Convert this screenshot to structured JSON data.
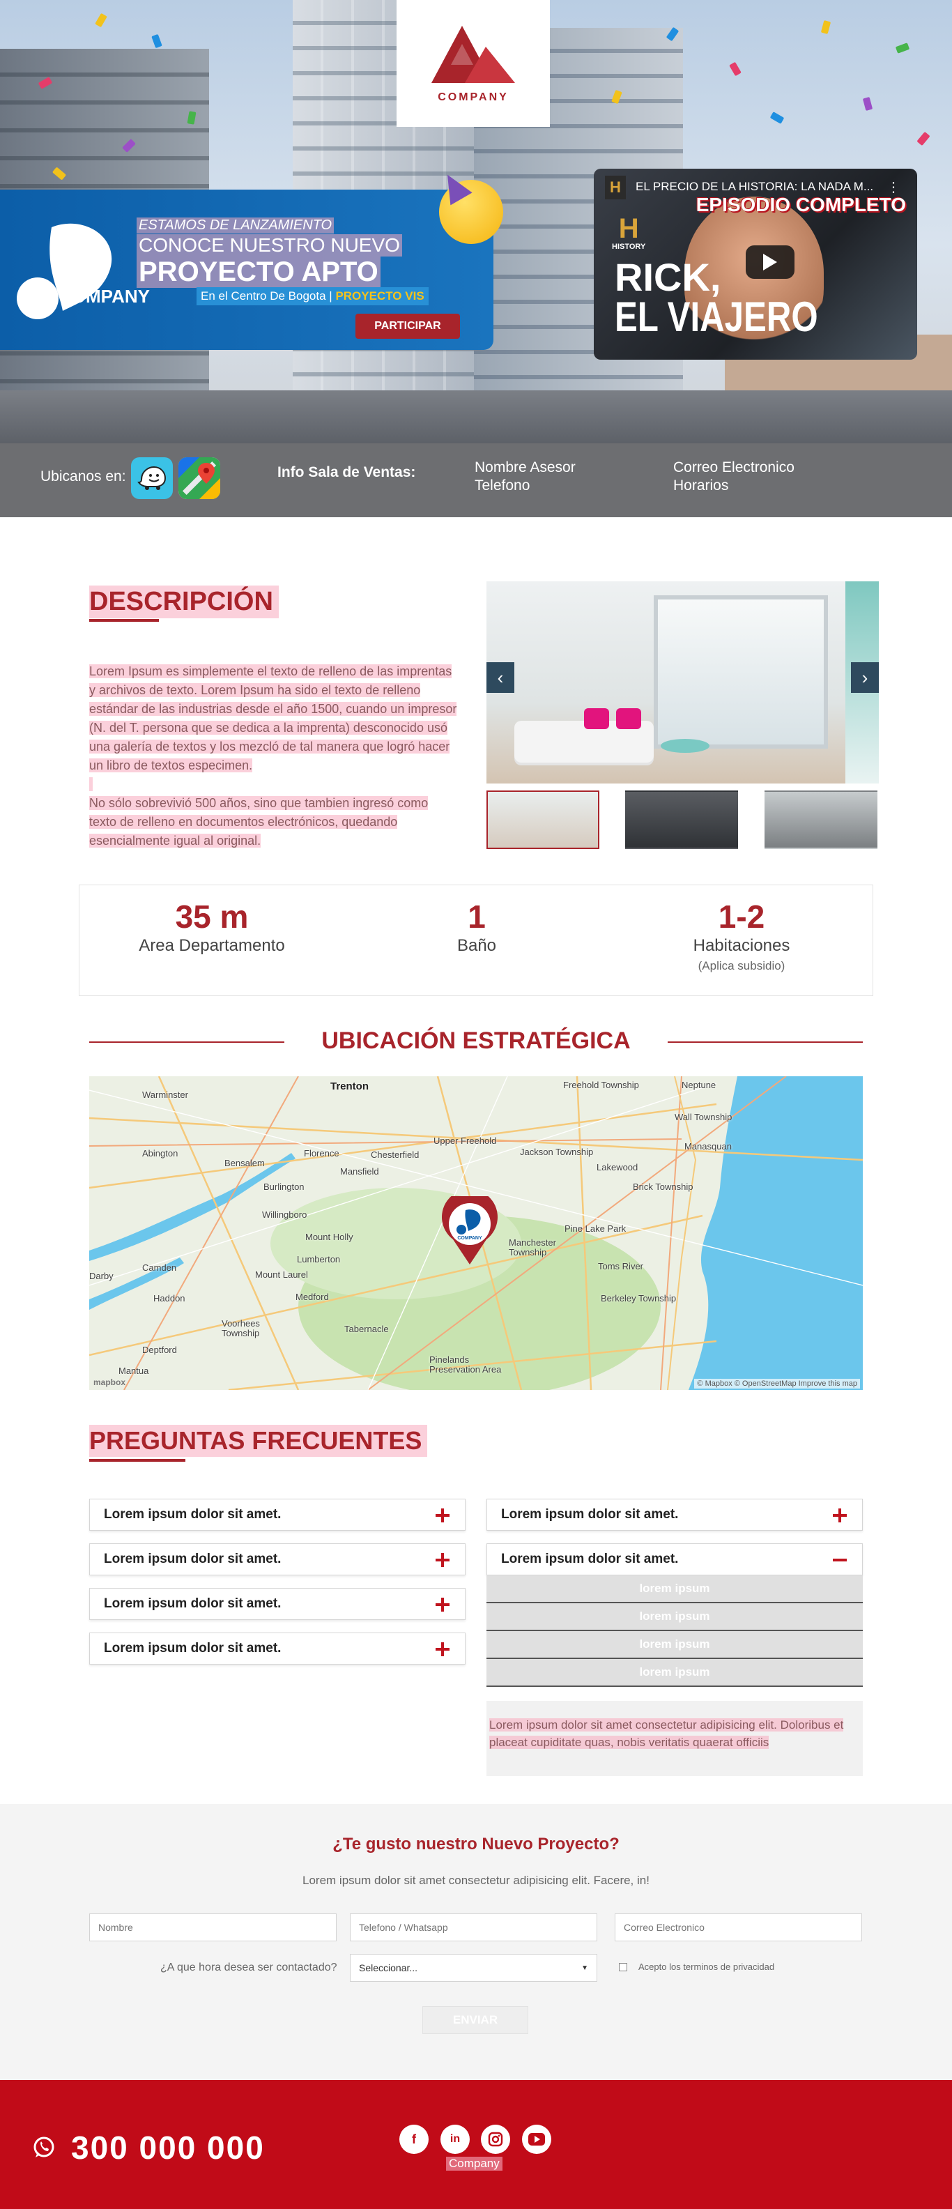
{
  "header": {
    "logo_text": "COMPANY"
  },
  "hero": {
    "brand_name": "COMPANY",
    "line1": "ESTAMOS DE LANZAMIENTO",
    "line2": "CONOCE NUESTRO NUEVO",
    "line3": "PROYECTO APTO",
    "location": "En el Centro De Bogota |",
    "vis": "PROYECTO VIS",
    "cta": "PARTICIPAR",
    "video": {
      "title": "EL PRECIO DE LA HISTORIA: LA NADA M...",
      "badge": "EPISODIO COMPLETO",
      "channel_letter": "H",
      "channel_name": "HISTORY",
      "show_line1": "RICK,",
      "show_line2": "EL VIAJERO"
    }
  },
  "infobar": {
    "ubicanos": "Ubicanos en:",
    "sala": "Info Sala de Ventas:",
    "nombre_asesor": "Nombre Asesor",
    "telefono": "Telefono",
    "correo": "Correo Electronico",
    "horarios": "Horarios"
  },
  "descripcion": {
    "title": "DESCRIPCIÓN",
    "p1": "Lorem Ipsum es simplemente el texto de relleno de las imprentas y archivos de texto. Lorem Ipsum ha sido el texto de relleno estándar de las industrias desde el año 1500, cuando un impresor (N. del T. persona que se dedica a la imprenta) desconocido usó una galería de textos y los mezcló de tal manera que logró hacer un libro de textos especimen.",
    "p2": "No sólo sobrevivió 500 años, sino que tambien ingresó como texto de relleno en documentos electrónicos, quedando esencialmente igual al original."
  },
  "stats": [
    {
      "value": "35 m",
      "label": "Area Departamento"
    },
    {
      "value": "1",
      "label": "Baño"
    },
    {
      "value": "1-2",
      "label": "Habitaciones",
      "sub": "(Aplica subsidio)"
    }
  ],
  "ubicacion": {
    "title": "UBICACIÓN ESTRATÉGICA",
    "map_logo": "COMPANY",
    "credit": "© Mapbox © OpenStreetMap Improve this map",
    "watermark": "mapbox",
    "places": [
      "Warminster",
      "Trenton",
      "Freehold Township",
      "Neptune",
      "Wall Township",
      "Abington",
      "Bensalem",
      "Florence",
      "Chesterfield",
      "Upper Freehold",
      "Jackson Township",
      "Lakewood",
      "Manasquan",
      "Burlington",
      "Mansfield",
      "Brick Township",
      "Willingboro",
      "Mount Holly",
      "Manchester Township",
      "Pine Lake Park",
      "Lumberton",
      "Toms River",
      "Camden",
      "Mount Laurel",
      "Medford",
      "Berkeley Township",
      "Haddon",
      "Voorhees Township",
      "Tabernacle",
      "Deptford",
      "Pinelands Preservation Area",
      "Mantua",
      "Darby"
    ]
  },
  "faq": {
    "title": "PREGUNTAS FRECUENTES",
    "left": [
      "Lorem ipsum dolor sit amet.",
      "Lorem ipsum dolor sit amet.",
      "Lorem ipsum dolor sit amet.",
      "Lorem ipsum dolor sit amet."
    ],
    "right": [
      "Lorem ipsum dolor sit amet.",
      "Lorem ipsum dolor sit amet."
    ],
    "sub_items": [
      "lorem ipsum",
      "lorem ipsum",
      "lorem ipsum",
      "lorem ipsum"
    ],
    "answer": "Lorem ipsum dolor sit amet consectetur adipisicing elit. Doloribus et placeat cupiditate quas, nobis veritatis quaerat officiis"
  },
  "form": {
    "title": "¿Te gusto nuestro Nuevo Proyecto?",
    "subtitle": "Lorem ipsum dolor sit amet consectetur adipisicing elit. Facere, in!",
    "nombre_placeholder": "Nombre",
    "telefono_placeholder": "Telefono / Whatsapp",
    "correo_placeholder": "Correo Electronico",
    "hora_label": "¿A que hora desea ser contactado?",
    "select_value": "Seleccionar...",
    "privacy": "Acepto los terminos de privacidad",
    "send": "ENVIAR"
  },
  "footer": {
    "phone": "300 000 000",
    "company": "Company",
    "social": [
      "facebook",
      "linkedin",
      "instagram",
      "youtube"
    ]
  },
  "colors": {
    "brand_red": "#a8242b",
    "footer_red": "#c10b18",
    "banner_blue": "#0c5ea8",
    "vis_yellow": "#f6c21b",
    "info_gray": "#6d6e71"
  }
}
